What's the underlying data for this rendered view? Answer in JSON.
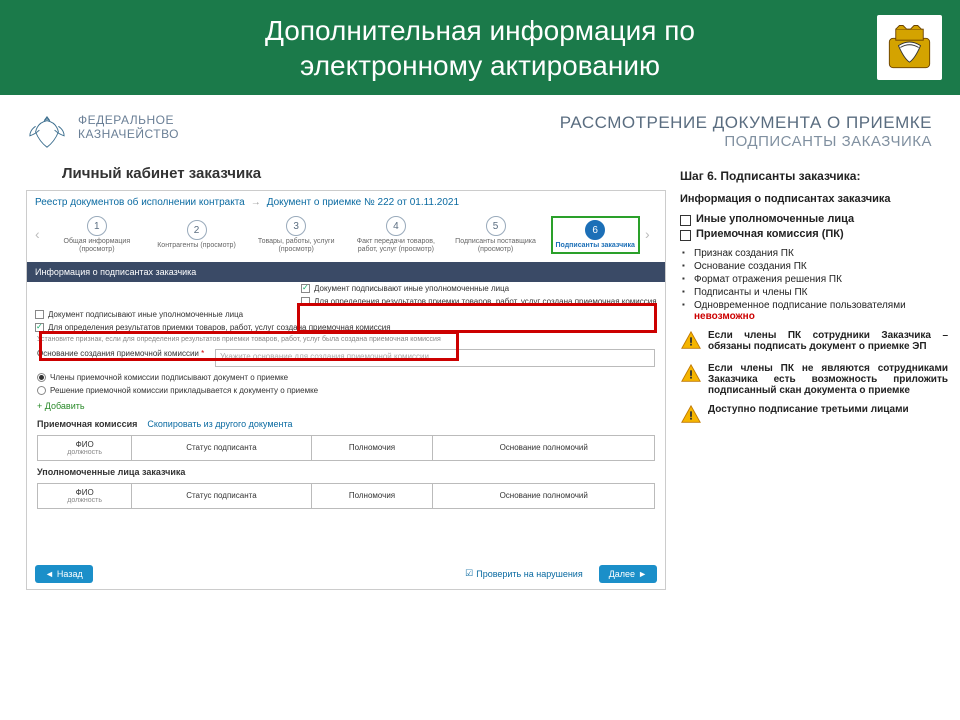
{
  "slide": {
    "title": "Дополнительная информация по\nэлектронному актированию"
  },
  "pageHead": {
    "agency_l1": "ФЕДЕРАЛЬНОЕ",
    "agency_l2": "КАЗНАЧЕЙСТВО",
    "right_l1": "РАССМОТРЕНИЕ ДОКУМЕНТА О ПРИЕМКЕ",
    "right_l2": "ПОДПИСАНТЫ ЗАКАЗЧИКА"
  },
  "lk_title": "Личный кабинет заказчика",
  "screenshot": {
    "bc1": "Реестр документов об исполнении контракта",
    "bc2": "Документ о приемке № 222 от 01.11.2021",
    "steps": [
      {
        "n": "1",
        "l": "Общая информация (просмотр)"
      },
      {
        "n": "2",
        "l": "Контрагенты (просмотр)"
      },
      {
        "n": "3",
        "l": "Товары, работы, услуги (просмотр)"
      },
      {
        "n": "4",
        "l": "Факт передачи товаров, работ, услуг (просмотр)"
      },
      {
        "n": "5",
        "l": "Подписанты поставщика (просмотр)"
      },
      {
        "n": "6",
        "l": "Подписанты заказчика"
      }
    ],
    "section_bar": "Информация о подписантах заказчика",
    "cb1": "Документ подписывают иные уполномоченные лица",
    "cb2": "Для определения результатов приемки товаров, работ, услуг создана приемочная комиссия",
    "cb3": "Документ подписывают иные уполномоченные лица",
    "cb4": "Для определения результатов приемки товаров, работ, услуг создана приемочная комиссия",
    "note": "Установите признак, если для определения результатов приемки товаров, работ, услуг была создана приемочная комиссия",
    "form_lbl": "Основание создания приемочной комиссии",
    "form_ph": "Укажите основание для создания приемочной комиссии",
    "radio1": "Члены приемочной комиссии подписывают документ о приемке",
    "radio2": "Решение приемочной комиссии прикладывается к документу о приемке",
    "add": "Добавить",
    "sub1": "Приемочная комиссия",
    "sub1_link": "Скопировать из другого документа",
    "sub2": "Уполномоченные лица заказчика",
    "th_fio": "ФИО",
    "th_fio_sub": "должность",
    "th_status": "Статус подписанта",
    "th_poln": "Полномочия",
    "th_osn": "Основание полномочий",
    "btn_back": "Назад",
    "btn_check": "Проверить на нарушения",
    "btn_next": "Далее"
  },
  "right": {
    "h4": "Шаг 6. Подписанты заказчика:",
    "h5": "Информация о подписантах заказчика",
    "sq": [
      "Иные уполномоченные лица",
      "Приемочная комиссия (ПК)"
    ],
    "dash": [
      "Признак создания ПК",
      "Основание создания ПК",
      "Формат отражения решения ПК",
      "Подписанты и члены ПК"
    ],
    "dash_last_a": "Одновременное подписание пользователями ",
    "dash_last_b": "невозможно",
    "warns": [
      "Если члены ПК сотрудники Заказчика – обязаны подписать документ о приемке ЭП",
      "Если члены ПК не являются сотрудниками Заказчика есть возможность приложить подписанный скан документа о приемке",
      "Доступно подписание третьими лицами"
    ]
  }
}
